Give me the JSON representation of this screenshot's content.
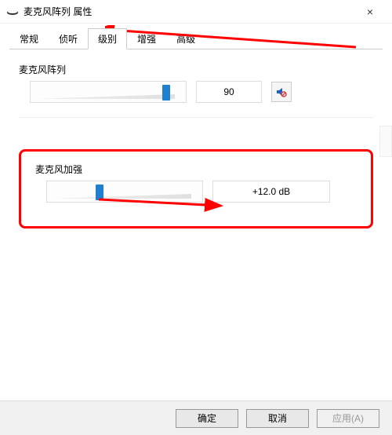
{
  "window": {
    "title": "麦克风阵列 属性",
    "close_label": "×"
  },
  "tabs": {
    "items": [
      {
        "label": "常规"
      },
      {
        "label": "侦听"
      },
      {
        "label": "级别"
      },
      {
        "label": "增强"
      },
      {
        "label": "高级"
      }
    ],
    "active_index": 2
  },
  "mic_array": {
    "label": "麦克风阵列",
    "value": "90",
    "slider_percent": 90
  },
  "boost": {
    "label": "麦克风加强",
    "value": "+12.0 dB",
    "slider_percent": 35
  },
  "footer": {
    "ok": "确定",
    "cancel": "取消",
    "apply": "应用(A)"
  },
  "icons": {
    "balance": "balance-icon"
  }
}
